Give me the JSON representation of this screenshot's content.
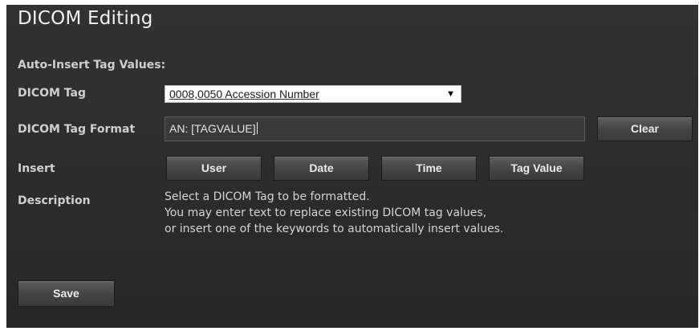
{
  "panel": {
    "title": "DICOM Editing",
    "section_label": "Auto-Insert Tag Values:"
  },
  "dicom_tag": {
    "label": "DICOM Tag",
    "selected": "0008,0050 Accession Number"
  },
  "tag_format": {
    "label": "DICOM Tag Format",
    "value": "AN: [TAGVALUE]",
    "clear_label": "Clear"
  },
  "insert": {
    "label": "Insert",
    "buttons": [
      "User",
      "Date",
      "Time",
      "Tag Value"
    ]
  },
  "description": {
    "label": "Description",
    "lines": [
      "Select a DICOM Tag to be formatted.",
      "You may enter text to replace existing DICOM tag values,",
      "or insert one of the keywords to automatically insert values."
    ]
  },
  "save_label": "Save",
  "colors": {
    "panel_background": "#2e2e2e",
    "button_background": "#4a4a4a",
    "text": "#d8d8d8"
  }
}
